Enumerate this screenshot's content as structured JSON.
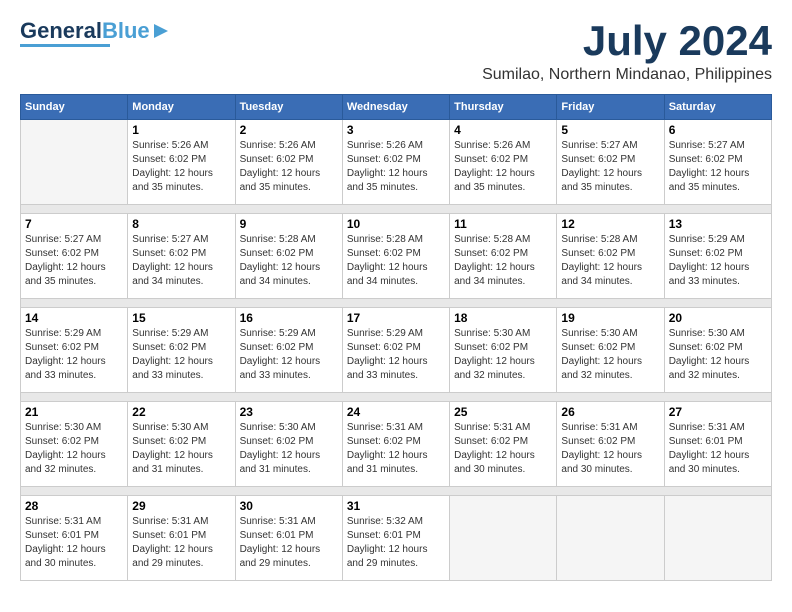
{
  "logo": {
    "text1": "General",
    "text2": "Blue"
  },
  "header": {
    "month_year": "July 2024",
    "location": "Sumilao, Northern Mindanao, Philippines"
  },
  "days_of_week": [
    "Sunday",
    "Monday",
    "Tuesday",
    "Wednesday",
    "Thursday",
    "Friday",
    "Saturday"
  ],
  "weeks": [
    {
      "days": [
        {
          "num": "",
          "info": ""
        },
        {
          "num": "1",
          "info": "Sunrise: 5:26 AM\nSunset: 6:02 PM\nDaylight: 12 hours\nand 35 minutes."
        },
        {
          "num": "2",
          "info": "Sunrise: 5:26 AM\nSunset: 6:02 PM\nDaylight: 12 hours\nand 35 minutes."
        },
        {
          "num": "3",
          "info": "Sunrise: 5:26 AM\nSunset: 6:02 PM\nDaylight: 12 hours\nand 35 minutes."
        },
        {
          "num": "4",
          "info": "Sunrise: 5:26 AM\nSunset: 6:02 PM\nDaylight: 12 hours\nand 35 minutes."
        },
        {
          "num": "5",
          "info": "Sunrise: 5:27 AM\nSunset: 6:02 PM\nDaylight: 12 hours\nand 35 minutes."
        },
        {
          "num": "6",
          "info": "Sunrise: 5:27 AM\nSunset: 6:02 PM\nDaylight: 12 hours\nand 35 minutes."
        }
      ]
    },
    {
      "days": [
        {
          "num": "7",
          "info": "Sunrise: 5:27 AM\nSunset: 6:02 PM\nDaylight: 12 hours\nand 35 minutes."
        },
        {
          "num": "8",
          "info": "Sunrise: 5:27 AM\nSunset: 6:02 PM\nDaylight: 12 hours\nand 34 minutes."
        },
        {
          "num": "9",
          "info": "Sunrise: 5:28 AM\nSunset: 6:02 PM\nDaylight: 12 hours\nand 34 minutes."
        },
        {
          "num": "10",
          "info": "Sunrise: 5:28 AM\nSunset: 6:02 PM\nDaylight: 12 hours\nand 34 minutes."
        },
        {
          "num": "11",
          "info": "Sunrise: 5:28 AM\nSunset: 6:02 PM\nDaylight: 12 hours\nand 34 minutes."
        },
        {
          "num": "12",
          "info": "Sunrise: 5:28 AM\nSunset: 6:02 PM\nDaylight: 12 hours\nand 34 minutes."
        },
        {
          "num": "13",
          "info": "Sunrise: 5:29 AM\nSunset: 6:02 PM\nDaylight: 12 hours\nand 33 minutes."
        }
      ]
    },
    {
      "days": [
        {
          "num": "14",
          "info": "Sunrise: 5:29 AM\nSunset: 6:02 PM\nDaylight: 12 hours\nand 33 minutes."
        },
        {
          "num": "15",
          "info": "Sunrise: 5:29 AM\nSunset: 6:02 PM\nDaylight: 12 hours\nand 33 minutes."
        },
        {
          "num": "16",
          "info": "Sunrise: 5:29 AM\nSunset: 6:02 PM\nDaylight: 12 hours\nand 33 minutes."
        },
        {
          "num": "17",
          "info": "Sunrise: 5:29 AM\nSunset: 6:02 PM\nDaylight: 12 hours\nand 33 minutes."
        },
        {
          "num": "18",
          "info": "Sunrise: 5:30 AM\nSunset: 6:02 PM\nDaylight: 12 hours\nand 32 minutes."
        },
        {
          "num": "19",
          "info": "Sunrise: 5:30 AM\nSunset: 6:02 PM\nDaylight: 12 hours\nand 32 minutes."
        },
        {
          "num": "20",
          "info": "Sunrise: 5:30 AM\nSunset: 6:02 PM\nDaylight: 12 hours\nand 32 minutes."
        }
      ]
    },
    {
      "days": [
        {
          "num": "21",
          "info": "Sunrise: 5:30 AM\nSunset: 6:02 PM\nDaylight: 12 hours\nand 32 minutes."
        },
        {
          "num": "22",
          "info": "Sunrise: 5:30 AM\nSunset: 6:02 PM\nDaylight: 12 hours\nand 31 minutes."
        },
        {
          "num": "23",
          "info": "Sunrise: 5:30 AM\nSunset: 6:02 PM\nDaylight: 12 hours\nand 31 minutes."
        },
        {
          "num": "24",
          "info": "Sunrise: 5:31 AM\nSunset: 6:02 PM\nDaylight: 12 hours\nand 31 minutes."
        },
        {
          "num": "25",
          "info": "Sunrise: 5:31 AM\nSunset: 6:02 PM\nDaylight: 12 hours\nand 30 minutes."
        },
        {
          "num": "26",
          "info": "Sunrise: 5:31 AM\nSunset: 6:02 PM\nDaylight: 12 hours\nand 30 minutes."
        },
        {
          "num": "27",
          "info": "Sunrise: 5:31 AM\nSunset: 6:01 PM\nDaylight: 12 hours\nand 30 minutes."
        }
      ]
    },
    {
      "days": [
        {
          "num": "28",
          "info": "Sunrise: 5:31 AM\nSunset: 6:01 PM\nDaylight: 12 hours\nand 30 minutes."
        },
        {
          "num": "29",
          "info": "Sunrise: 5:31 AM\nSunset: 6:01 PM\nDaylight: 12 hours\nand 29 minutes."
        },
        {
          "num": "30",
          "info": "Sunrise: 5:31 AM\nSunset: 6:01 PM\nDaylight: 12 hours\nand 29 minutes."
        },
        {
          "num": "31",
          "info": "Sunrise: 5:32 AM\nSunset: 6:01 PM\nDaylight: 12 hours\nand 29 minutes."
        },
        {
          "num": "",
          "info": ""
        },
        {
          "num": "",
          "info": ""
        },
        {
          "num": "",
          "info": ""
        }
      ]
    }
  ]
}
